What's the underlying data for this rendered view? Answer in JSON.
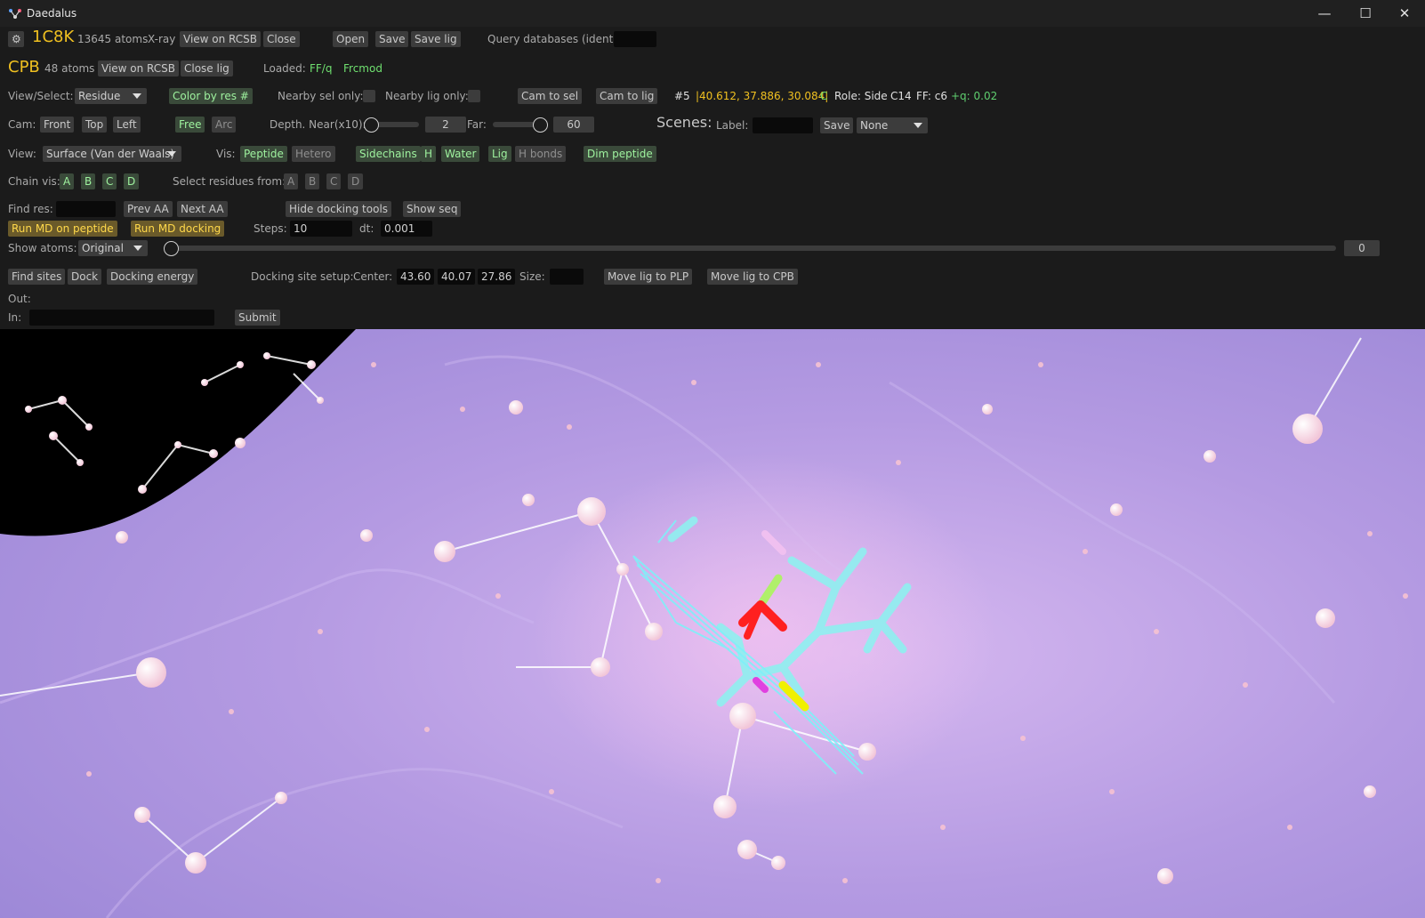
{
  "window": {
    "title": "Daedalus",
    "controls": {
      "minimize": "—",
      "maximize": "☐",
      "close": "✕"
    }
  },
  "row1": {
    "settings_icon": "gear-icon",
    "protein_id": "1C8K",
    "atom_count": "13645 atoms",
    "method": "X-ray",
    "view_rcsb": "View on RCSB",
    "close": "Close",
    "open": "Open",
    "save": "Save",
    "save_lig": "Save lig",
    "query_label": "Query databases (ident):",
    "query_value": ""
  },
  "row2": {
    "ligand_id": "CPB",
    "atom_count": "48 atoms",
    "view_rcsb": "View on RCSB",
    "close_lig": "Close lig",
    "loaded_label": "Loaded:",
    "loaded_items": [
      "FF/q",
      "Frcmod"
    ]
  },
  "row3": {
    "view_select_label": "View/Select:",
    "view_select_value": "Residue",
    "color_by_res": "Color by res #",
    "nearby_sel_label": "Nearby sel only:",
    "nearby_lig_label": "Nearby lig only:",
    "cam_to_sel": "Cam to sel",
    "cam_to_lig": "Cam to lig",
    "sel_index": "#5",
    "sel_coords": "|40.612, 37.886, 30.084|",
    "sel_element": "C",
    "role": "Role: Side",
    "atom_name": "C14",
    "ff_type": "FF: c6",
    "charge": "+q: 0.02"
  },
  "row4": {
    "cam_label": "Cam:",
    "front": "Front",
    "top": "Top",
    "left": "Left",
    "free": "Free",
    "arc": "Arc",
    "depth_near_label": "Depth. Near(x10):",
    "depth_near_value": "2",
    "far_label": "Far:",
    "far_value": "60",
    "scenes_label": "Scenes:",
    "label_label": "Label:",
    "label_value": "",
    "save": "Save",
    "scene_select": "None"
  },
  "row5": {
    "view_label": "View:",
    "view_value": "Surface (Van der Waals)",
    "vis_label": "Vis:",
    "peptide": "Peptide",
    "hetero": "Hetero",
    "sidechains": "Sidechains",
    "h": "H",
    "water": "Water",
    "lig": "Lig",
    "h_bonds": "H bonds",
    "dim_peptide": "Dim peptide"
  },
  "row6": {
    "chain_vis_label": "Chain vis:",
    "chains": [
      "A",
      "B",
      "C",
      "D"
    ],
    "select_residues_label": "Select residues from:",
    "select_chains": [
      "A",
      "B",
      "C",
      "D"
    ]
  },
  "row7": {
    "find_res_label": "Find res:",
    "find_res_value": "",
    "prev_aa": "Prev AA",
    "next_aa": "Next AA",
    "hide_docking": "Hide docking tools",
    "show_seq": "Show seq"
  },
  "row8": {
    "run_md_peptide": "Run MD on peptide",
    "run_md_docking": "Run MD docking",
    "steps_label": "Steps:",
    "steps_value": "10",
    "dt_label": "dt:",
    "dt_value": "0.001"
  },
  "row9": {
    "show_atoms_label": "Show atoms:",
    "show_atoms_value": "Original",
    "slider_value": "0"
  },
  "row10": {
    "find_sites": "Find sites",
    "dock": "Dock",
    "docking_energy": "Docking energy",
    "docking_setup_label": "Docking site setup:",
    "center_label": "Center:",
    "center": [
      "43.60",
      "40.07",
      "27.86"
    ],
    "size_label": "Size:",
    "size_value": "",
    "move_lig_plp": "Move lig to PLP",
    "move_lig_cpb": "Move lig to CPB"
  },
  "row11": {
    "out_label": "Out:"
  },
  "row12": {
    "in_label": "In:",
    "in_value": "",
    "submit": "Submit"
  },
  "colors": {
    "accent_yellow": "#f0c020",
    "active_green": "#9ff39f",
    "surface_purple": "#b89ee0",
    "ligand_cyan": "#8ff0f0",
    "oxygen_red": "#ff2020",
    "sulfur_yellow": "#f0f000"
  }
}
